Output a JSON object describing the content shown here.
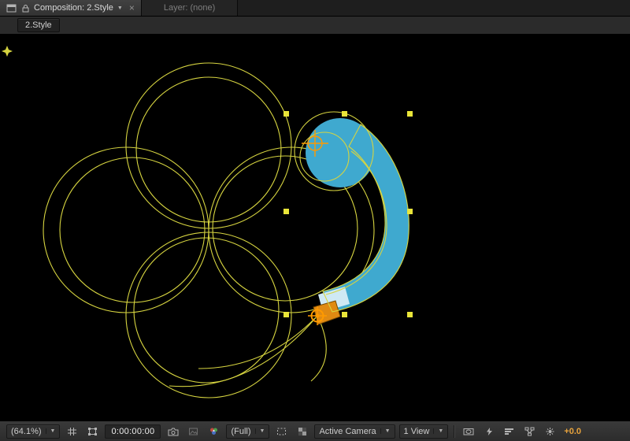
{
  "panel": {
    "tabs": [
      {
        "label": "Composition: 2.Style",
        "active": true
      },
      {
        "label": "Layer: (none)",
        "active": false
      }
    ],
    "breadcrumb": "2.Style"
  },
  "toolbar": {
    "zoom": "(64.1%)",
    "timecode": "0:00:00:00",
    "resolution": "(Full)",
    "camera_view": "Active Camera",
    "view_layout": "1 View",
    "exposure": "+0.0"
  },
  "glyphs": {
    "dropdown": "▼",
    "close": "×"
  },
  "colors": {
    "shape_fill": "#3fa9cf",
    "tail_highlight": "#cfe9f4",
    "tail_orange": "#e08a12",
    "path_yellow": "#d6d440",
    "handle_yellow": "#e9e539",
    "anchor_orange": "#ff9a00",
    "exposure_text": "#e8a33c"
  }
}
